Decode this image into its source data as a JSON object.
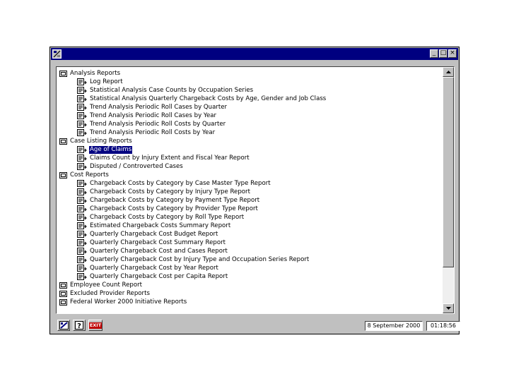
{
  "window": {
    "minimize_glyph": "_",
    "maximize_glyph": "□",
    "close_glyph": "×"
  },
  "tree": [
    {
      "text": "Analysis Reports",
      "level": 0,
      "icon": "folder-open-icon"
    },
    {
      "text": "Log Report",
      "level": 1,
      "icon": "report-icon"
    },
    {
      "text": "Statistical Analysis Case Counts by Occupation Series",
      "level": 1,
      "icon": "report-icon"
    },
    {
      "text": "Statistical Analysis Quarterly Chargeback Costs by Age, Gender and Job Class",
      "level": 1,
      "icon": "report-icon"
    },
    {
      "text": "Trend Analysis Periodic Roll Cases by Quarter",
      "level": 1,
      "icon": "report-icon"
    },
    {
      "text": "Trend Analysis Periodic Roll Cases by Year",
      "level": 1,
      "icon": "report-icon"
    },
    {
      "text": "Trend Analysis Periodic Roll Costs by Quarter",
      "level": 1,
      "icon": "report-icon"
    },
    {
      "text": "Trend Analysis Periodic Roll Costs by Year",
      "level": 1,
      "icon": "report-icon"
    },
    {
      "text": "Case Listing Reports",
      "level": 0,
      "icon": "folder-open-icon"
    },
    {
      "text": "Age of Claims",
      "level": 1,
      "icon": "report-icon",
      "selected": true
    },
    {
      "text": "Claims Count by Injury Extent and Fiscal Year Report",
      "level": 1,
      "icon": "report-icon"
    },
    {
      "text": "Disputed / Controverted Cases",
      "level": 1,
      "icon": "report-icon"
    },
    {
      "text": "Cost Reports",
      "level": 0,
      "icon": "folder-open-icon"
    },
    {
      "text": "Chargeback Costs by Category by Case Master Type Report",
      "level": 1,
      "icon": "report-icon"
    },
    {
      "text": "Chargeback Costs by Category by Injury Type Report",
      "level": 1,
      "icon": "report-icon"
    },
    {
      "text": "Chargeback Costs by Category by Payment Type Report",
      "level": 1,
      "icon": "report-icon"
    },
    {
      "text": "Chargeback Costs by Category by Provider Type Report",
      "level": 1,
      "icon": "report-icon"
    },
    {
      "text": "Chargeback Costs by Category by Roll Type Report",
      "level": 1,
      "icon": "report-icon"
    },
    {
      "text": "Estimated Chargeback Costs Summary Report",
      "level": 1,
      "icon": "report-icon"
    },
    {
      "text": "Quarterly Chargeback Cost Budget Report",
      "level": 1,
      "icon": "report-icon"
    },
    {
      "text": "Quarterly Chargeback Cost Summary Report",
      "level": 1,
      "icon": "report-icon"
    },
    {
      "text": "Quarterly Chargeback Cost and Cases Report",
      "level": 1,
      "icon": "report-icon"
    },
    {
      "text": "Quarterly Chargeback Cost by Injury Type and Occupation Series Report",
      "level": 1,
      "icon": "report-icon"
    },
    {
      "text": "Quarterly Chargeback Cost by Year Report",
      "level": 1,
      "icon": "report-icon"
    },
    {
      "text": "Quarterly Chargeback Cost per Capita Report",
      "level": 1,
      "icon": "report-icon"
    },
    {
      "text": "Employee Count Report",
      "level": 0,
      "icon": "folder-open-icon"
    },
    {
      "text": "Excluded Provider Reports",
      "level": 0,
      "icon": "folder-open-icon"
    },
    {
      "text": "Federal Worker 2000 Initiative Reports",
      "level": 0,
      "icon": "folder-open-icon"
    }
  ],
  "status": {
    "exit_label": "EXIT",
    "date": "8 September 2000",
    "time": "01:18:56"
  }
}
